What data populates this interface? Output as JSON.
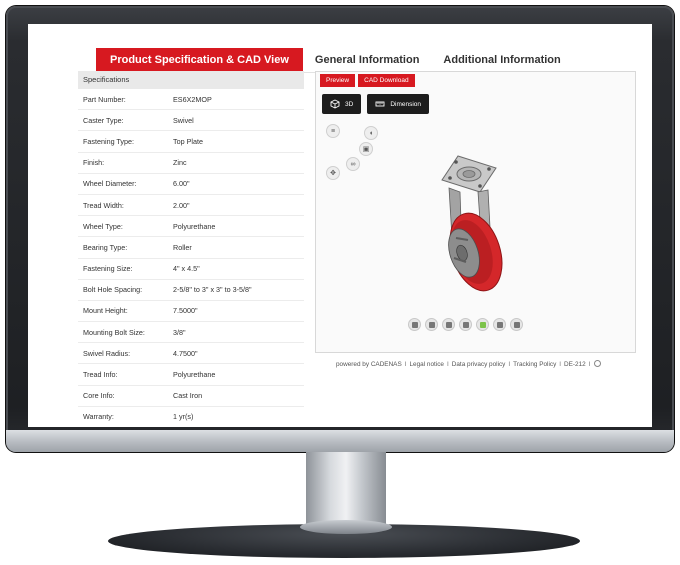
{
  "tabs": [
    {
      "label": "Product Specification & CAD View",
      "active": true
    },
    {
      "label": "General Information",
      "active": false
    },
    {
      "label": "Additional Information",
      "active": false
    }
  ],
  "specs": {
    "header": "Specifications",
    "rows": [
      {
        "key": "Part Number:",
        "value": "ES6X2MOP"
      },
      {
        "key": "Caster Type:",
        "value": "Swivel"
      },
      {
        "key": "Fastening Type:",
        "value": "Top Plate"
      },
      {
        "key": "Finish:",
        "value": "Zinc"
      },
      {
        "key": "Wheel Diameter:",
        "value": "6.00\""
      },
      {
        "key": "Tread Width:",
        "value": "2.00\""
      },
      {
        "key": "Wheel Type:",
        "value": "Polyurethane"
      },
      {
        "key": "Bearing Type:",
        "value": "Roller"
      },
      {
        "key": "Fastening Size:",
        "value": "4\" x 4.5\""
      },
      {
        "key": "Bolt Hole Spacing:",
        "value": "2-5/8\" to 3\" x 3\" to 3-5/8\""
      },
      {
        "key": "Mount Height:",
        "value": "7.5000\""
      },
      {
        "key": "Mounting Bolt Size:",
        "value": "3/8\""
      },
      {
        "key": "Swivel Radius:",
        "value": "4.7500\""
      },
      {
        "key": "Tread Info:",
        "value": "Polyurethane"
      },
      {
        "key": "Core Info:",
        "value": "Cast Iron"
      },
      {
        "key": "Warranty:",
        "value": "1 yr(s)"
      }
    ]
  },
  "cad": {
    "preview_tab": "Preview",
    "download_tab": "CAD Download",
    "btn_3d": "3D",
    "btn_dimension": "Dimension"
  },
  "footer": {
    "powered_by": "powered by CADENAS",
    "legal": "Legal notice",
    "privacy": "Data privacy policy",
    "tracking": "Tracking Policy",
    "locale": "DE-212"
  },
  "colors": {
    "accent": "#d71920",
    "wheel": "#d4272a"
  }
}
